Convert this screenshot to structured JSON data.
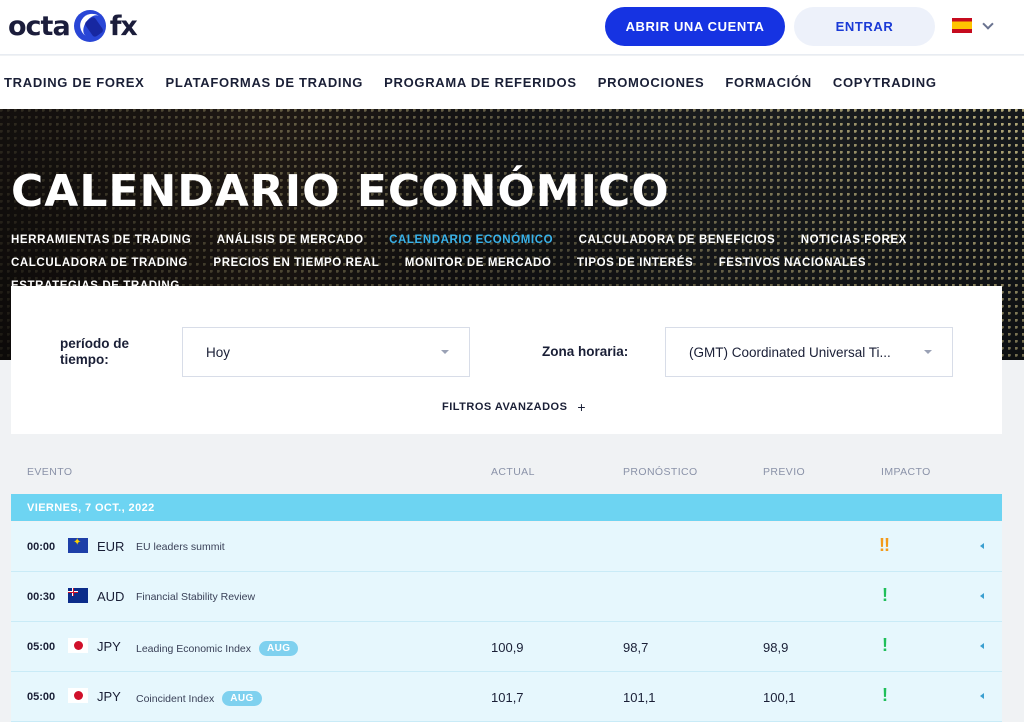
{
  "header": {
    "logo_left": "octa",
    "logo_right": "fx",
    "open_account_label": "ABRIR UNA CUENTA",
    "login_label": "ENTRAR",
    "language_flag": "spain-flag"
  },
  "nav": {
    "items": [
      "TRADING DE FOREX",
      "PLATAFORMAS DE TRADING",
      "PROGRAMA DE REFERIDOS",
      "PROMOCIONES",
      "FORMACIÓN",
      "COPYTRADING"
    ]
  },
  "hero": {
    "title": "CALENDARIO ECONÓMICO",
    "subnav": [
      "HERRAMIENTAS DE TRADING",
      "ANÁLISIS DE MERCADO",
      "CALENDARIO ECONÓMICO",
      "CALCULADORA DE BENEFICIOS",
      "NOTICIAS FOREX",
      "CALCULADORA DE TRADING",
      "PRECIOS EN TIEMPO REAL",
      "MONITOR DE MERCADO",
      "TIPOS DE INTERÉS",
      "FESTIVOS NACIONALES",
      "ESTRATEGIAS DE TRADING"
    ],
    "active_subnav": "CALENDARIO ECONÓMICO"
  },
  "filters": {
    "period_label_line1": "período de",
    "period_label_line2": "tiempo:",
    "period_value": "Hoy",
    "timezone_label": "Zona horaria:",
    "timezone_value": "(GMT) Coordinated Universal Ti...",
    "advanced_label": "FILTROS AVANZADOS",
    "advanced_icon": "+"
  },
  "table": {
    "columns": {
      "event": "EVENTO",
      "actual": "ACTUAL",
      "forecast": "PRONÓSTICO",
      "previous": "PREVIO",
      "impact": "IMPACTO"
    },
    "day_label": "VIERNES, 7 OCT., 2022",
    "colors": {
      "day_bar": "#6dd4f2",
      "impact_high": "#f39a1a",
      "impact_low": "#1fbf5a"
    },
    "rows": [
      {
        "time": "00:00",
        "flag": "eu-flag",
        "currency": "EUR",
        "event": "EU leaders summit",
        "badge": "",
        "actual": "",
        "forecast": "",
        "previous": "",
        "impact": "!!",
        "impact_color": "#f39a1a"
      },
      {
        "time": "00:30",
        "flag": "australia-flag",
        "currency": "AUD",
        "event": "Financial Stability Review",
        "badge": "",
        "actual": "",
        "forecast": "",
        "previous": "",
        "impact": "!",
        "impact_color": "#1fbf5a"
      },
      {
        "time": "05:00",
        "flag": "japan-flag",
        "currency": "JPY",
        "event": "Leading Economic Index",
        "badge": "AUG",
        "actual": "100,9",
        "forecast": "98,7",
        "previous": "98,9",
        "impact": "!",
        "impact_color": "#1fbf5a"
      },
      {
        "time": "05:00",
        "flag": "japan-flag",
        "currency": "JPY",
        "event": "Coincident Index",
        "badge": "AUG",
        "actual": "101,7",
        "forecast": "101,1",
        "previous": "100,1",
        "impact": "!",
        "impact_color": "#1fbf5a"
      }
    ]
  }
}
